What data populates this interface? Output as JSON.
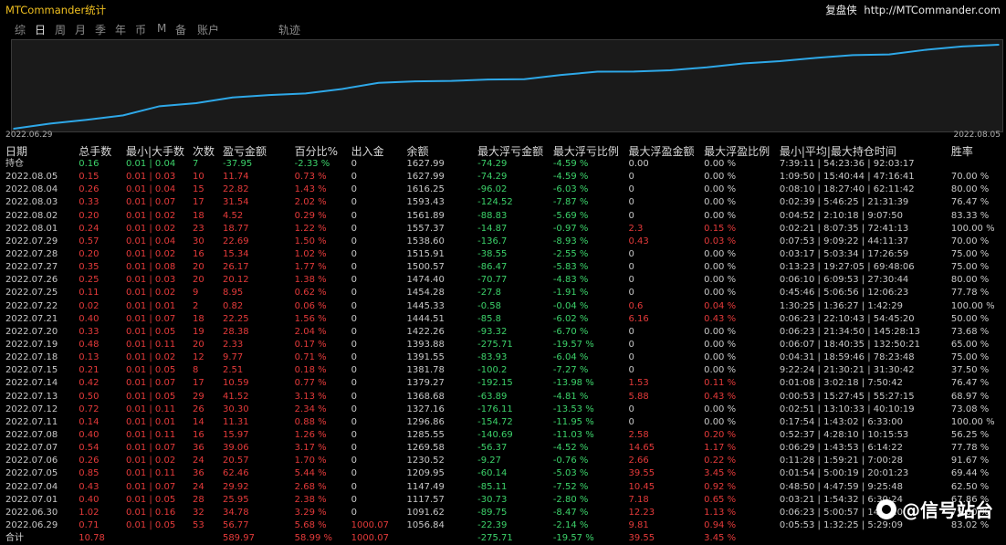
{
  "header": {
    "app_title": "MTCommander统计",
    "brand": "复盘侠",
    "url": "http://MTCommander.com"
  },
  "tabs": [
    "综",
    "日",
    "周",
    "月",
    "季",
    "年",
    "币",
    "M",
    "备",
    "账户",
    "轨迹"
  ],
  "active_tab": 1,
  "chart": {
    "date_start": "2022.06.29",
    "date_end": "2022.08.05",
    "line_color": "#2ea8e8"
  },
  "chart_data": {
    "type": "line",
    "x": [
      "2022.06.29",
      "2022.06.30",
      "2022.07.01",
      "2022.07.04",
      "2022.07.05",
      "2022.07.06",
      "2022.07.07",
      "2022.07.08",
      "2022.07.11",
      "2022.07.12",
      "2022.07.13",
      "2022.07.14",
      "2022.07.15",
      "2022.07.18",
      "2022.07.19",
      "2022.07.20",
      "2022.07.21",
      "2022.07.22",
      "2022.07.25",
      "2022.07.26",
      "2022.07.27",
      "2022.07.28",
      "2022.07.29",
      "2022.08.01",
      "2022.08.02",
      "2022.08.03",
      "2022.08.04",
      "2022.08.05"
    ],
    "y": [
      1056.84,
      1091.62,
      1117.57,
      1147.49,
      1209.95,
      1230.52,
      1269.58,
      1285.55,
      1296.86,
      1327.16,
      1368.68,
      1379.27,
      1381.78,
      1391.55,
      1393.88,
      1422.26,
      1444.51,
      1445.33,
      1454.28,
      1474.4,
      1500.57,
      1515.91,
      1538.6,
      1557.37,
      1561.89,
      1593.43,
      1616.25,
      1627.99
    ],
    "title": "",
    "xlabel": "",
    "ylabel": ""
  },
  "columns": [
    "日期",
    "总手数",
    "最小|大手数",
    "次数",
    "盈亏金额",
    "百分比%",
    "出入金",
    "余额",
    "最大浮亏金额",
    "最大浮亏比例",
    "最大浮盈金额",
    "最大浮盈比例",
    "最小|平均|最大持仓时间",
    "胜率"
  ],
  "holding": [
    "持仓",
    "0.16",
    "0.01 | 0.04",
    "7",
    "-37.95",
    "-2.33 %",
    "0",
    "1627.99",
    "-74.29",
    "-4.59 %",
    "0.00",
    "0.00 %",
    "7:39:11 | 54:23:36 | 92:03:17",
    ""
  ],
  "rows": [
    [
      "2022.08.05",
      "0.15",
      "0.01 | 0.03",
      "10",
      "11.74",
      "0.73 %",
      "0",
      "1627.99",
      "-74.29",
      "-4.59 %",
      "0",
      "0.00 %",
      "1:09:50 | 15:40:44 | 47:16:41",
      "70.00 %"
    ],
    [
      "2022.08.04",
      "0.26",
      "0.01 | 0.04",
      "15",
      "22.82",
      "1.43 %",
      "0",
      "1616.25",
      "-96.02",
      "-6.03 %",
      "0",
      "0.00 %",
      "0:08:10 | 18:27:40 | 62:11:42",
      "80.00 %"
    ],
    [
      "2022.08.03",
      "0.33",
      "0.01 | 0.07",
      "17",
      "31.54",
      "2.02 %",
      "0",
      "1593.43",
      "-124.52",
      "-7.87 %",
      "0",
      "0.00 %",
      "0:02:39 | 5:46:25 | 21:31:39",
      "76.47 %"
    ],
    [
      "2022.08.02",
      "0.20",
      "0.01 | 0.02",
      "18",
      "4.52",
      "0.29 %",
      "0",
      "1561.89",
      "-88.83",
      "-5.69 %",
      "0",
      "0.00 %",
      "0:04:52 | 2:10:18 | 9:07:50",
      "83.33 %"
    ],
    [
      "2022.08.01",
      "0.24",
      "0.01 | 0.02",
      "23",
      "18.77",
      "1.22 %",
      "0",
      "1557.37",
      "-14.87",
      "-0.97 %",
      "2.3",
      "0.15 %",
      "0:02:21 | 8:07:35 | 72:41:13",
      "100.00 %"
    ],
    [
      "2022.07.29",
      "0.57",
      "0.01 | 0.04",
      "30",
      "22.69",
      "1.50 %",
      "0",
      "1538.60",
      "-136.7",
      "-8.93 %",
      "0.43",
      "0.03 %",
      "0:07:53 | 9:09:22 | 44:11:37",
      "70.00 %"
    ],
    [
      "2022.07.28",
      "0.20",
      "0.01 | 0.02",
      "16",
      "15.34",
      "1.02 %",
      "0",
      "1515.91",
      "-38.55",
      "-2.55 %",
      "0",
      "0.00 %",
      "0:03:17 | 5:03:34 | 17:26:59",
      "75.00 %"
    ],
    [
      "2022.07.27",
      "0.35",
      "0.01 | 0.08",
      "20",
      "26.17",
      "1.77 %",
      "0",
      "1500.57",
      "-86.47",
      "-5.83 %",
      "0",
      "0.00 %",
      "0:13:23 | 19:27:05 | 69:48:06",
      "75.00 %"
    ],
    [
      "2022.07.26",
      "0.25",
      "0.01 | 0.03",
      "20",
      "20.12",
      "1.38 %",
      "0",
      "1474.40",
      "-70.77",
      "-4.83 %",
      "0",
      "0.00 %",
      "0:06:10 | 6:09:53 | 27:30:44",
      "80.00 %"
    ],
    [
      "2022.07.25",
      "0.11",
      "0.01 | 0.02",
      "9",
      "8.95",
      "0.62 %",
      "0",
      "1454.28",
      "-27.8",
      "-1.91 %",
      "0",
      "0.00 %",
      "0:45:46 | 5:06:56 | 12:06:23",
      "77.78 %"
    ],
    [
      "2022.07.22",
      "0.02",
      "0.01 | 0.01",
      "2",
      "0.82",
      "0.06 %",
      "0",
      "1445.33",
      "-0.58",
      "-0.04 %",
      "0.6",
      "0.04 %",
      "1:30:25 | 1:36:27 | 1:42:29",
      "100.00 %"
    ],
    [
      "2022.07.21",
      "0.40",
      "0.01 | 0.07",
      "18",
      "22.25",
      "1.56 %",
      "0",
      "1444.51",
      "-85.8",
      "-6.02 %",
      "6.16",
      "0.43 %",
      "0:06:23 | 22:10:43 | 54:45:20",
      "50.00 %"
    ],
    [
      "2022.07.20",
      "0.33",
      "0.01 | 0.05",
      "19",
      "28.38",
      "2.04 %",
      "0",
      "1422.26",
      "-93.32",
      "-6.70 %",
      "0",
      "0.00 %",
      "0:06:23 | 21:34:50 | 145:28:13",
      "73.68 %"
    ],
    [
      "2022.07.19",
      "0.48",
      "0.01 | 0.11",
      "20",
      "2.33",
      "0.17 %",
      "0",
      "1393.88",
      "-275.71",
      "-19.57 %",
      "0",
      "0.00 %",
      "0:06:07 | 18:40:35 | 132:50:21",
      "65.00 %"
    ],
    [
      "2022.07.18",
      "0.13",
      "0.01 | 0.02",
      "12",
      "9.77",
      "0.71 %",
      "0",
      "1391.55",
      "-83.93",
      "-6.04 %",
      "0",
      "0.00 %",
      "0:04:31 | 18:59:46 | 78:23:48",
      "75.00 %"
    ],
    [
      "2022.07.15",
      "0.21",
      "0.01 | 0.05",
      "8",
      "2.51",
      "0.18 %",
      "0",
      "1381.78",
      "-100.2",
      "-7.27 %",
      "0",
      "0.00 %",
      "9:22:24 | 21:30:21 | 31:30:42",
      "37.50 %"
    ],
    [
      "2022.07.14",
      "0.42",
      "0.01 | 0.07",
      "17",
      "10.59",
      "0.77 %",
      "0",
      "1379.27",
      "-192.15",
      "-13.98 %",
      "1.53",
      "0.11 %",
      "0:01:08 | 3:02:18 | 7:50:42",
      "76.47 %"
    ],
    [
      "2022.07.13",
      "0.50",
      "0.01 | 0.05",
      "29",
      "41.52",
      "3.13 %",
      "0",
      "1368.68",
      "-63.89",
      "-4.81 %",
      "5.88",
      "0.43 %",
      "0:00:53 | 15:27:45 | 55:27:15",
      "68.97 %"
    ],
    [
      "2022.07.12",
      "0.72",
      "0.01 | 0.11",
      "26",
      "30.30",
      "2.34 %",
      "0",
      "1327.16",
      "-176.11",
      "-13.53 %",
      "0",
      "0.00 %",
      "0:02:51 | 13:10:33 | 40:10:19",
      "73.08 %"
    ],
    [
      "2022.07.11",
      "0.14",
      "0.01 | 0.01",
      "14",
      "11.31",
      "0.88 %",
      "0",
      "1296.86",
      "-154.72",
      "-11.95 %",
      "0",
      "0.00 %",
      "0:17:54 | 1:43:02 | 6:33:00",
      "100.00 %"
    ],
    [
      "2022.07.08",
      "0.40",
      "0.01 | 0.11",
      "16",
      "15.97",
      "1.26 %",
      "0",
      "1285.55",
      "-140.69",
      "-11.03 %",
      "2.58",
      "0.20 %",
      "0:52:37 | 4:28:10 | 10:15:53",
      "56.25 %"
    ],
    [
      "2022.07.07",
      "0.54",
      "0.01 | 0.07",
      "36",
      "39.06",
      "3.17 %",
      "0",
      "1269.58",
      "-56.37",
      "-4.52 %",
      "14.65",
      "1.17 %",
      "0:06:29 | 1:43:53 | 6:14:22",
      "77.78 %"
    ],
    [
      "2022.07.06",
      "0.26",
      "0.01 | 0.02",
      "24",
      "20.57",
      "1.70 %",
      "0",
      "1230.52",
      "-9.27",
      "-0.76 %",
      "2.66",
      "0.22 %",
      "0:11:28 | 1:59:21 | 7:00:28",
      "91.67 %"
    ],
    [
      "2022.07.05",
      "0.85",
      "0.01 | 0.11",
      "36",
      "62.46",
      "5.44 %",
      "0",
      "1209.95",
      "-60.14",
      "-5.03 %",
      "39.55",
      "3.45 %",
      "0:01:54 | 5:00:19 | 20:01:23",
      "69.44 %"
    ],
    [
      "2022.07.04",
      "0.43",
      "0.01 | 0.07",
      "24",
      "29.92",
      "2.68 %",
      "0",
      "1147.49",
      "-85.11",
      "-7.52 %",
      "10.45",
      "0.92 %",
      "0:48:50 | 4:47:59 | 9:25:48",
      "62.50 %"
    ],
    [
      "2022.07.01",
      "0.40",
      "0.01 | 0.05",
      "28",
      "25.95",
      "2.38 %",
      "0",
      "1117.57",
      "-30.73",
      "-2.80 %",
      "7.18",
      "0.65 %",
      "0:03:21 | 1:54:32 | 6:30:24",
      "67.86 %"
    ],
    [
      "2022.06.30",
      "1.02",
      "0.01 | 0.16",
      "32",
      "34.78",
      "3.29 %",
      "0",
      "1091.62",
      "-89.75",
      "-8.47 %",
      "12.23",
      "1.13 %",
      "0:06:23 | 5:00:57 | 14:14:0",
      "75.00 %"
    ],
    [
      "2022.06.29",
      "0.71",
      "0.01 | 0.05",
      "53",
      "56.77",
      "5.68 %",
      "1000.07",
      "1056.84",
      "-22.39",
      "-2.14 %",
      "9.81",
      "0.94 %",
      "0:05:53 | 1:32:25 | 5:29:09",
      "83.02 %"
    ]
  ],
  "total": [
    "合计",
    "10.78",
    "",
    "",
    "589.97",
    "58.99 %",
    "1000.07",
    "",
    "-275.71",
    "-19.57 %",
    "39.55",
    "3.45 %",
    "",
    ""
  ],
  "watermark": "@信号站台"
}
